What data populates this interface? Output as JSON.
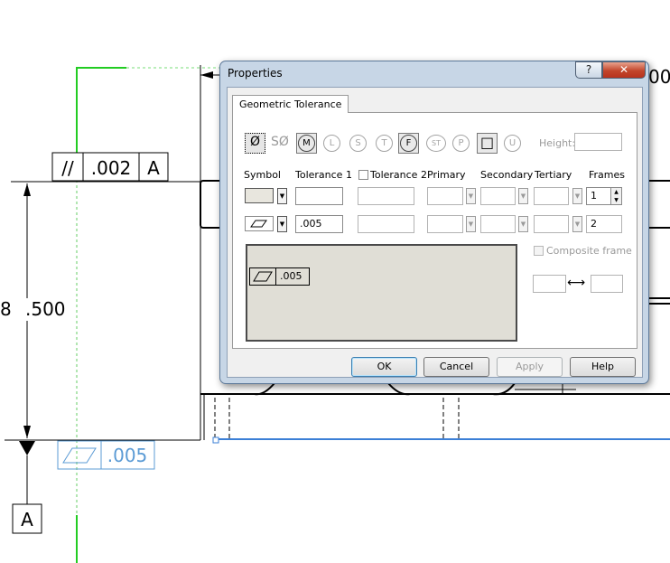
{
  "drawing": {
    "fcf_top": {
      "modifier": "//",
      "value": ".002",
      "datum": "A"
    },
    "dimension": ".500",
    "partial_dimension": "00",
    "fcf_bottom": {
      "value": ".005"
    },
    "datum_label": "A"
  },
  "dialog": {
    "title": "Properties",
    "help_glyph": "?",
    "close_glyph": "✕",
    "tab": "Geometric Tolerance",
    "symbols": [
      {
        "label": "Ø",
        "enabled": true
      },
      {
        "label": "SØ",
        "enabled": false
      },
      {
        "label": "M",
        "enabled": true
      },
      {
        "label": "L",
        "enabled": false
      },
      {
        "label": "S",
        "enabled": false
      },
      {
        "label": "T",
        "enabled": false
      },
      {
        "label": "F",
        "enabled": true
      },
      {
        "label": "ST",
        "enabled": false
      },
      {
        "label": "P",
        "enabled": false
      },
      {
        "label": "□",
        "enabled": true
      },
      {
        "label": "U",
        "enabled": false
      }
    ],
    "height_label": "Height:",
    "columns": {
      "symbol": "Symbol",
      "tolerance1": "Tolerance 1",
      "tolerance2": "Tolerance 2",
      "primary": "Primary",
      "secondary": "Secondary",
      "tertiary": "Tertiary",
      "frames": "Frames"
    },
    "rows": [
      {
        "tolerance1": "",
        "tolerance2": "",
        "primary": "",
        "secondary": "",
        "tertiary": "",
        "frame": "1"
      },
      {
        "tolerance1": ".005",
        "tolerance2": "",
        "primary": "",
        "secondary": "",
        "tertiary": "",
        "frame": "2"
      }
    ],
    "preview": {
      "value": ".005"
    },
    "composite_frame": "Composite frame",
    "buttons": {
      "ok": "OK",
      "cancel": "Cancel",
      "apply": "Apply",
      "help": "Help"
    }
  }
}
